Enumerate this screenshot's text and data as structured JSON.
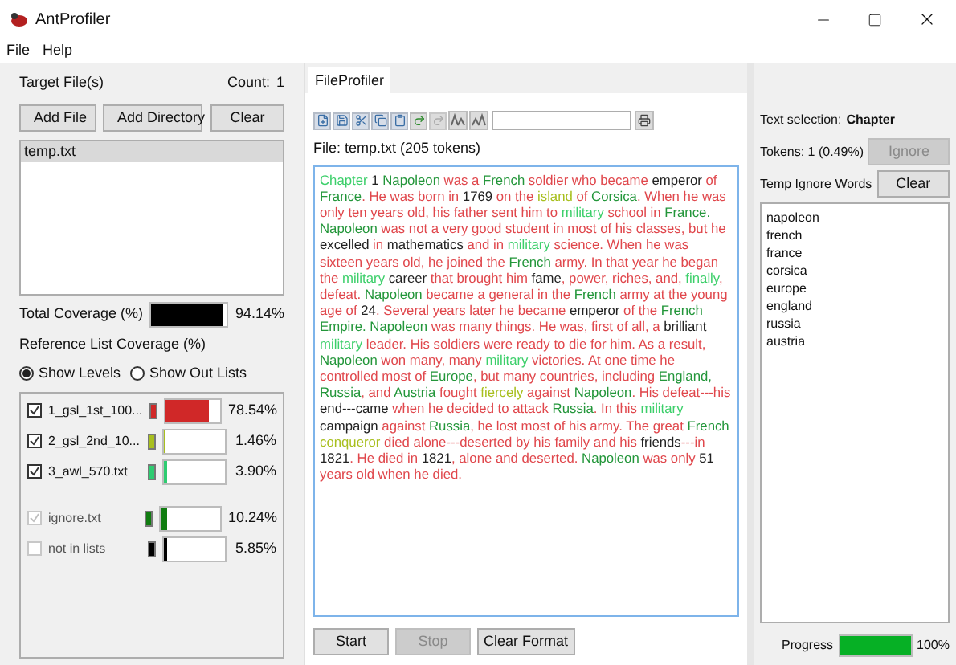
{
  "window": {
    "title": "AntProfiler"
  },
  "menu": [
    "File",
    "Help"
  ],
  "targets": {
    "label": "Target File(s)",
    "count_label": "Count:",
    "count": "1",
    "buttons": [
      "Add File",
      "Add Directory",
      "Clear"
    ],
    "files": [
      {
        "name": "temp.txt",
        "selected": true
      }
    ]
  },
  "total_coverage": {
    "label": "Total Coverage (%)",
    "color": "#000000",
    "level": 0.9414,
    "reading": "94.14%"
  },
  "reference": {
    "label": "Reference List Coverage (%)",
    "modes": [
      {
        "label": "Show Levels",
        "selected": true
      },
      {
        "label": "Show Out Lists",
        "selected": false
      }
    ],
    "items": [
      {
        "kind": "level",
        "name": "1_gsl_1st_100...",
        "checked": true,
        "disabled": false,
        "color": "#d02828",
        "level": 0.7854,
        "reading": "78.54%"
      },
      {
        "kind": "level",
        "name": "2_gsl_2nd_10...",
        "checked": true,
        "disabled": false,
        "color": "#a8bf1e",
        "level": 0.0146,
        "reading": "1.46%"
      },
      {
        "kind": "level",
        "name": "3_awl_570.txt",
        "checked": true,
        "disabled": false,
        "color": "#2ecc71",
        "level": 0.039,
        "reading": "3.90%"
      },
      {
        "kind": "extra",
        "name": "ignore.txt",
        "checked": true,
        "disabled": true,
        "color": "#107c10",
        "level": 0.1024,
        "reading": "10.24%"
      },
      {
        "kind": "extra",
        "name": "not in lists",
        "checked": false,
        "disabled": true,
        "color": "#000000",
        "level": 0.0585,
        "reading": "5.85%"
      }
    ]
  },
  "tabs": [
    {
      "label": "FileProfiler",
      "selected": true
    }
  ],
  "file_info": "File:  temp.txt   (205 tokens)",
  "text": [
    {
      "t": "Chapter",
      "color": "#3ccf6a"
    },
    {
      "t": " 1",
      "color": "#222222"
    },
    {
      "t": " Napoleon",
      "color": "#23963a"
    },
    {
      "t": " was a",
      "color": "#e0474c"
    },
    {
      "t": " French",
      "color": "#23963a"
    },
    {
      "t": " soldier who became",
      "color": "#e0474c"
    },
    {
      "t": " emperor",
      "color": "#222222"
    },
    {
      "t": " of",
      "color": "#e0474c"
    },
    {
      "t": " France",
      "color": "#23963a"
    },
    {
      "t": ". He was born in",
      "color": "#e0474c"
    },
    {
      "t": " 1769",
      "color": "#222222"
    },
    {
      "t": " on the",
      "color": "#e0474c"
    },
    {
      "t": " island",
      "color": "#a8bf1e"
    },
    {
      "t": " of",
      "color": "#e0474c"
    },
    {
      "t": " Corsica",
      "color": "#23963a"
    },
    {
      "t": ". When he was only ten years old, his father sent him to",
      "color": "#e0474c"
    },
    {
      "t": " military",
      "color": "#3ccf6a"
    },
    {
      "t": " school in",
      "color": "#e0474c"
    },
    {
      "t": " France.",
      "color": "#23963a"
    },
    {
      "t": " Napoleon",
      "color": "#23963a"
    },
    {
      "t": " was not a very good student in most of his classes, but he",
      "color": "#e0474c"
    },
    {
      "t": " excelled",
      "color": "#222222"
    },
    {
      "t": " in",
      "color": "#e0474c"
    },
    {
      "t": " mathematics",
      "color": "#222222"
    },
    {
      "t": " and in",
      "color": "#e0474c"
    },
    {
      "t": " military",
      "color": "#3ccf6a"
    },
    {
      "t": " science. When he was sixteen years old, he joined the",
      "color": "#e0474c"
    },
    {
      "t": " French",
      "color": "#23963a"
    },
    {
      "t": " army. In that year he began the",
      "color": "#e0474c"
    },
    {
      "t": " military",
      "color": "#3ccf6a"
    },
    {
      "t": " career",
      "color": "#222222"
    },
    {
      "t": " that brought him",
      "color": "#e0474c"
    },
    {
      "t": " fame",
      "color": "#222222"
    },
    {
      "t": ", power, riches, and,",
      "color": "#e0474c"
    },
    {
      "t": " finally",
      "color": "#3ccf6a"
    },
    {
      "t": ", defeat.",
      "color": "#e0474c"
    },
    {
      "t": " Napoleon",
      "color": "#23963a"
    },
    {
      "t": " became a general in the",
      "color": "#e0474c"
    },
    {
      "t": " French",
      "color": "#23963a"
    },
    {
      "t": " army at the young age of",
      "color": "#e0474c"
    },
    {
      "t": " 24",
      "color": "#222222"
    },
    {
      "t": ". Several years later he became",
      "color": "#e0474c"
    },
    {
      "t": " emperor",
      "color": "#222222"
    },
    {
      "t": " of the",
      "color": "#e0474c"
    },
    {
      "t": " French Empire.",
      "color": "#23963a"
    },
    {
      "t": " Napoleon",
      "color": "#23963a"
    },
    {
      "t": " was many things. He was, first of all, a",
      "color": "#e0474c"
    },
    {
      "t": " brilliant",
      "color": "#222222"
    },
    {
      "t": " military",
      "color": "#3ccf6a"
    },
    {
      "t": " leader. His soldiers were ready to die for him. As a result,",
      "color": "#e0474c"
    },
    {
      "t": " Napoleon",
      "color": "#23963a"
    },
    {
      "t": " won many, many",
      "color": "#e0474c"
    },
    {
      "t": " military",
      "color": "#3ccf6a"
    },
    {
      "t": " victories. At one time he controlled most of",
      "color": "#e0474c"
    },
    {
      "t": " Europe",
      "color": "#23963a"
    },
    {
      "t": ", but many countries, including",
      "color": "#e0474c"
    },
    {
      "t": " England,",
      "color": "#23963a"
    },
    {
      "t": " Russia",
      "color": "#23963a"
    },
    {
      "t": ", and",
      "color": "#e0474c"
    },
    {
      "t": " Austria",
      "color": "#23963a"
    },
    {
      "t": " fought",
      "color": "#e0474c"
    },
    {
      "t": " fiercely",
      "color": "#a8bf1e"
    },
    {
      "t": " against",
      "color": "#e0474c"
    },
    {
      "t": " Napoleon",
      "color": "#23963a"
    },
    {
      "t": ". His defeat---his",
      "color": "#e0474c"
    },
    {
      "t": " end---came",
      "color": "#222222"
    },
    {
      "t": " when he decided to attack",
      "color": "#e0474c"
    },
    {
      "t": " Russia",
      "color": "#23963a"
    },
    {
      "t": ". In this",
      "color": "#e0474c"
    },
    {
      "t": " military",
      "color": "#3ccf6a"
    },
    {
      "t": " campaign",
      "color": "#222222"
    },
    {
      "t": " against",
      "color": "#e0474c"
    },
    {
      "t": " Russia",
      "color": "#23963a"
    },
    {
      "t": ", he lost most of his army. The great",
      "color": "#e0474c"
    },
    {
      "t": " French",
      "color": "#23963a"
    },
    {
      "t": " conqueror",
      "color": "#a8bf1e"
    },
    {
      "t": " died alone---deserted by his family and his",
      "color": "#e0474c"
    },
    {
      "t": " friends",
      "color": "#222222"
    },
    {
      "t": "---in",
      "color": "#e0474c"
    },
    {
      "t": " 1821",
      "color": "#222222"
    },
    {
      "t": ". He died in",
      "color": "#e0474c"
    },
    {
      "t": " 1821",
      "color": "#222222"
    },
    {
      "t": ", alone and deserted.",
      "color": "#e0474c"
    },
    {
      "t": " Napoleon",
      "color": "#23963a"
    },
    {
      "t": " was only",
      "color": "#e0474c"
    },
    {
      "t": " 51",
      "color": "#222222"
    },
    {
      "t": " years old when he died.",
      "color": "#e0474c"
    }
  ],
  "actions": [
    {
      "label": "Start",
      "disabled": false
    },
    {
      "label": "Stop",
      "disabled": true
    },
    {
      "label": "Clear Format",
      "disabled": false
    }
  ],
  "selection": {
    "label": "Text selection:",
    "value": "Chapter",
    "tokens": "Tokens: 1 (0.49%)",
    "ignore_button": {
      "label": "Ignore",
      "disabled": true
    }
  },
  "ignore_words": {
    "label": "Temp Ignore Words",
    "clear": "Clear",
    "words": [
      "napoleon",
      "french",
      "france",
      "corsica",
      "europe",
      "england",
      "russia",
      "austria"
    ]
  },
  "progress": {
    "label": "Progress",
    "level": 1,
    "reading": "100%"
  }
}
